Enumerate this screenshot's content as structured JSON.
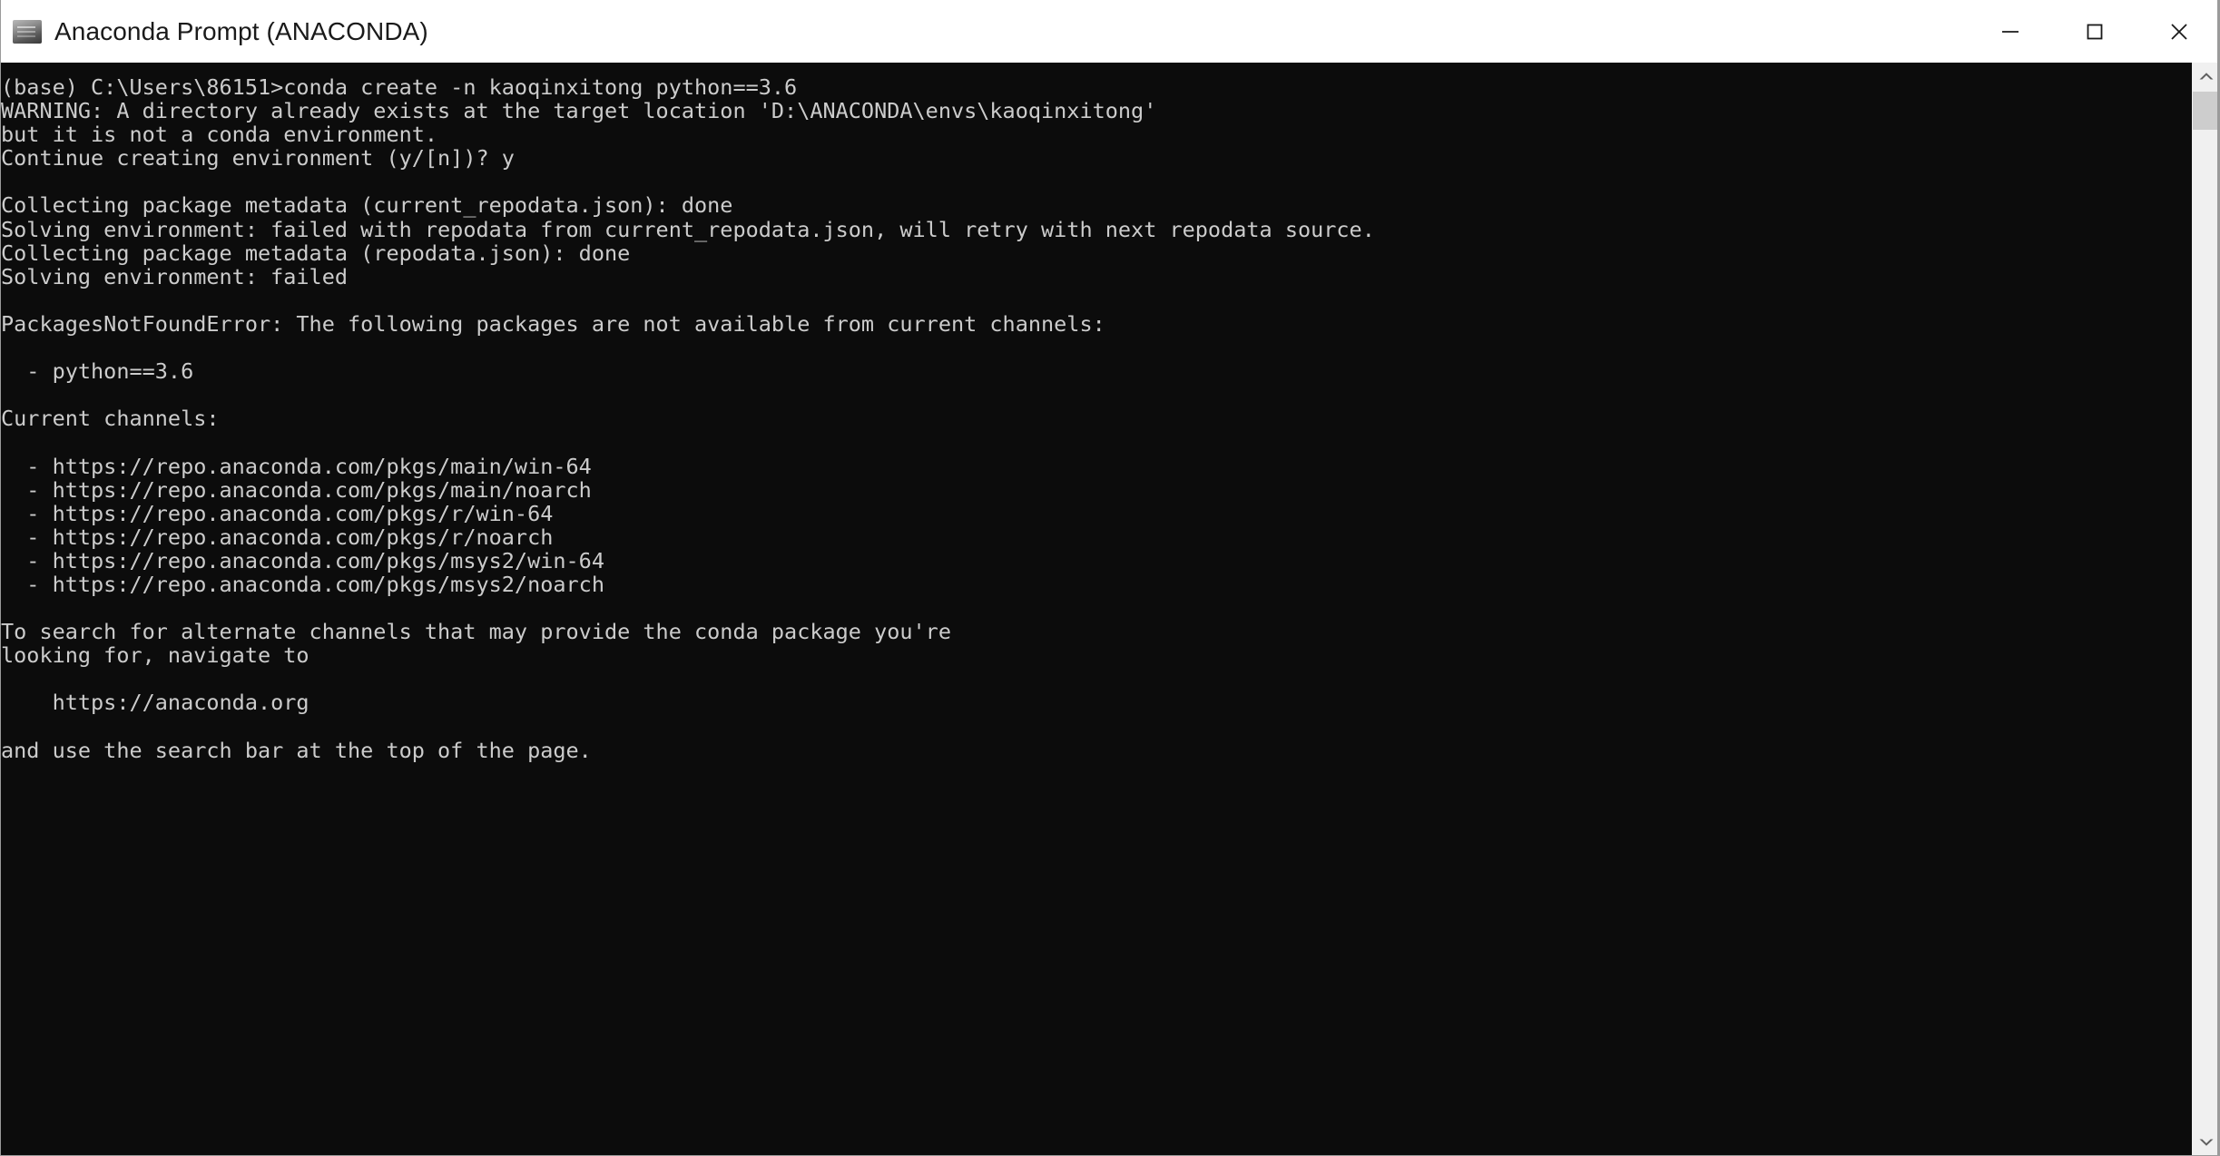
{
  "window": {
    "title": "Anaconda Prompt (ANACONDA)",
    "icon": "console-icon",
    "controls": {
      "minimize": "minimize-icon",
      "maximize": "maximize-icon",
      "close": "close-icon"
    },
    "colors": {
      "titlebar_background": "#ffffff",
      "title_text": "#1a1a1a",
      "console_background": "#0c0c0c",
      "console_text": "#cccccc",
      "scrollbar_track": "#f0f0f0",
      "scrollbar_thumb": "#cdcdcd"
    }
  },
  "scrollbar": {
    "up_arrow": "chevron-up-icon",
    "down_arrow": "chevron-down-icon",
    "thumb": "scroll-thumb"
  },
  "terminal": {
    "lines": [
      "(base) C:\\Users\\86151>conda create -n kaoqinxitong python==3.6",
      "WARNING: A directory already exists at the target location 'D:\\ANACONDA\\envs\\kaoqinxitong'",
      "but it is not a conda environment.",
      "Continue creating environment (y/[n])? y",
      "",
      "Collecting package metadata (current_repodata.json): done",
      "Solving environment: failed with repodata from current_repodata.json, will retry with next repodata source.",
      "Collecting package metadata (repodata.json): done",
      "Solving environment: failed",
      "",
      "PackagesNotFoundError: The following packages are not available from current channels:",
      "",
      "  - python==3.6",
      "",
      "Current channels:",
      "",
      "  - https://repo.anaconda.com/pkgs/main/win-64",
      "  - https://repo.anaconda.com/pkgs/main/noarch",
      "  - https://repo.anaconda.com/pkgs/r/win-64",
      "  - https://repo.anaconda.com/pkgs/r/noarch",
      "  - https://repo.anaconda.com/pkgs/msys2/win-64",
      "  - https://repo.anaconda.com/pkgs/msys2/noarch",
      "",
      "To search for alternate channels that may provide the conda package you're",
      "looking for, navigate to",
      "",
      "    https://anaconda.org",
      "",
      "and use the search bar at the top of the page."
    ]
  }
}
